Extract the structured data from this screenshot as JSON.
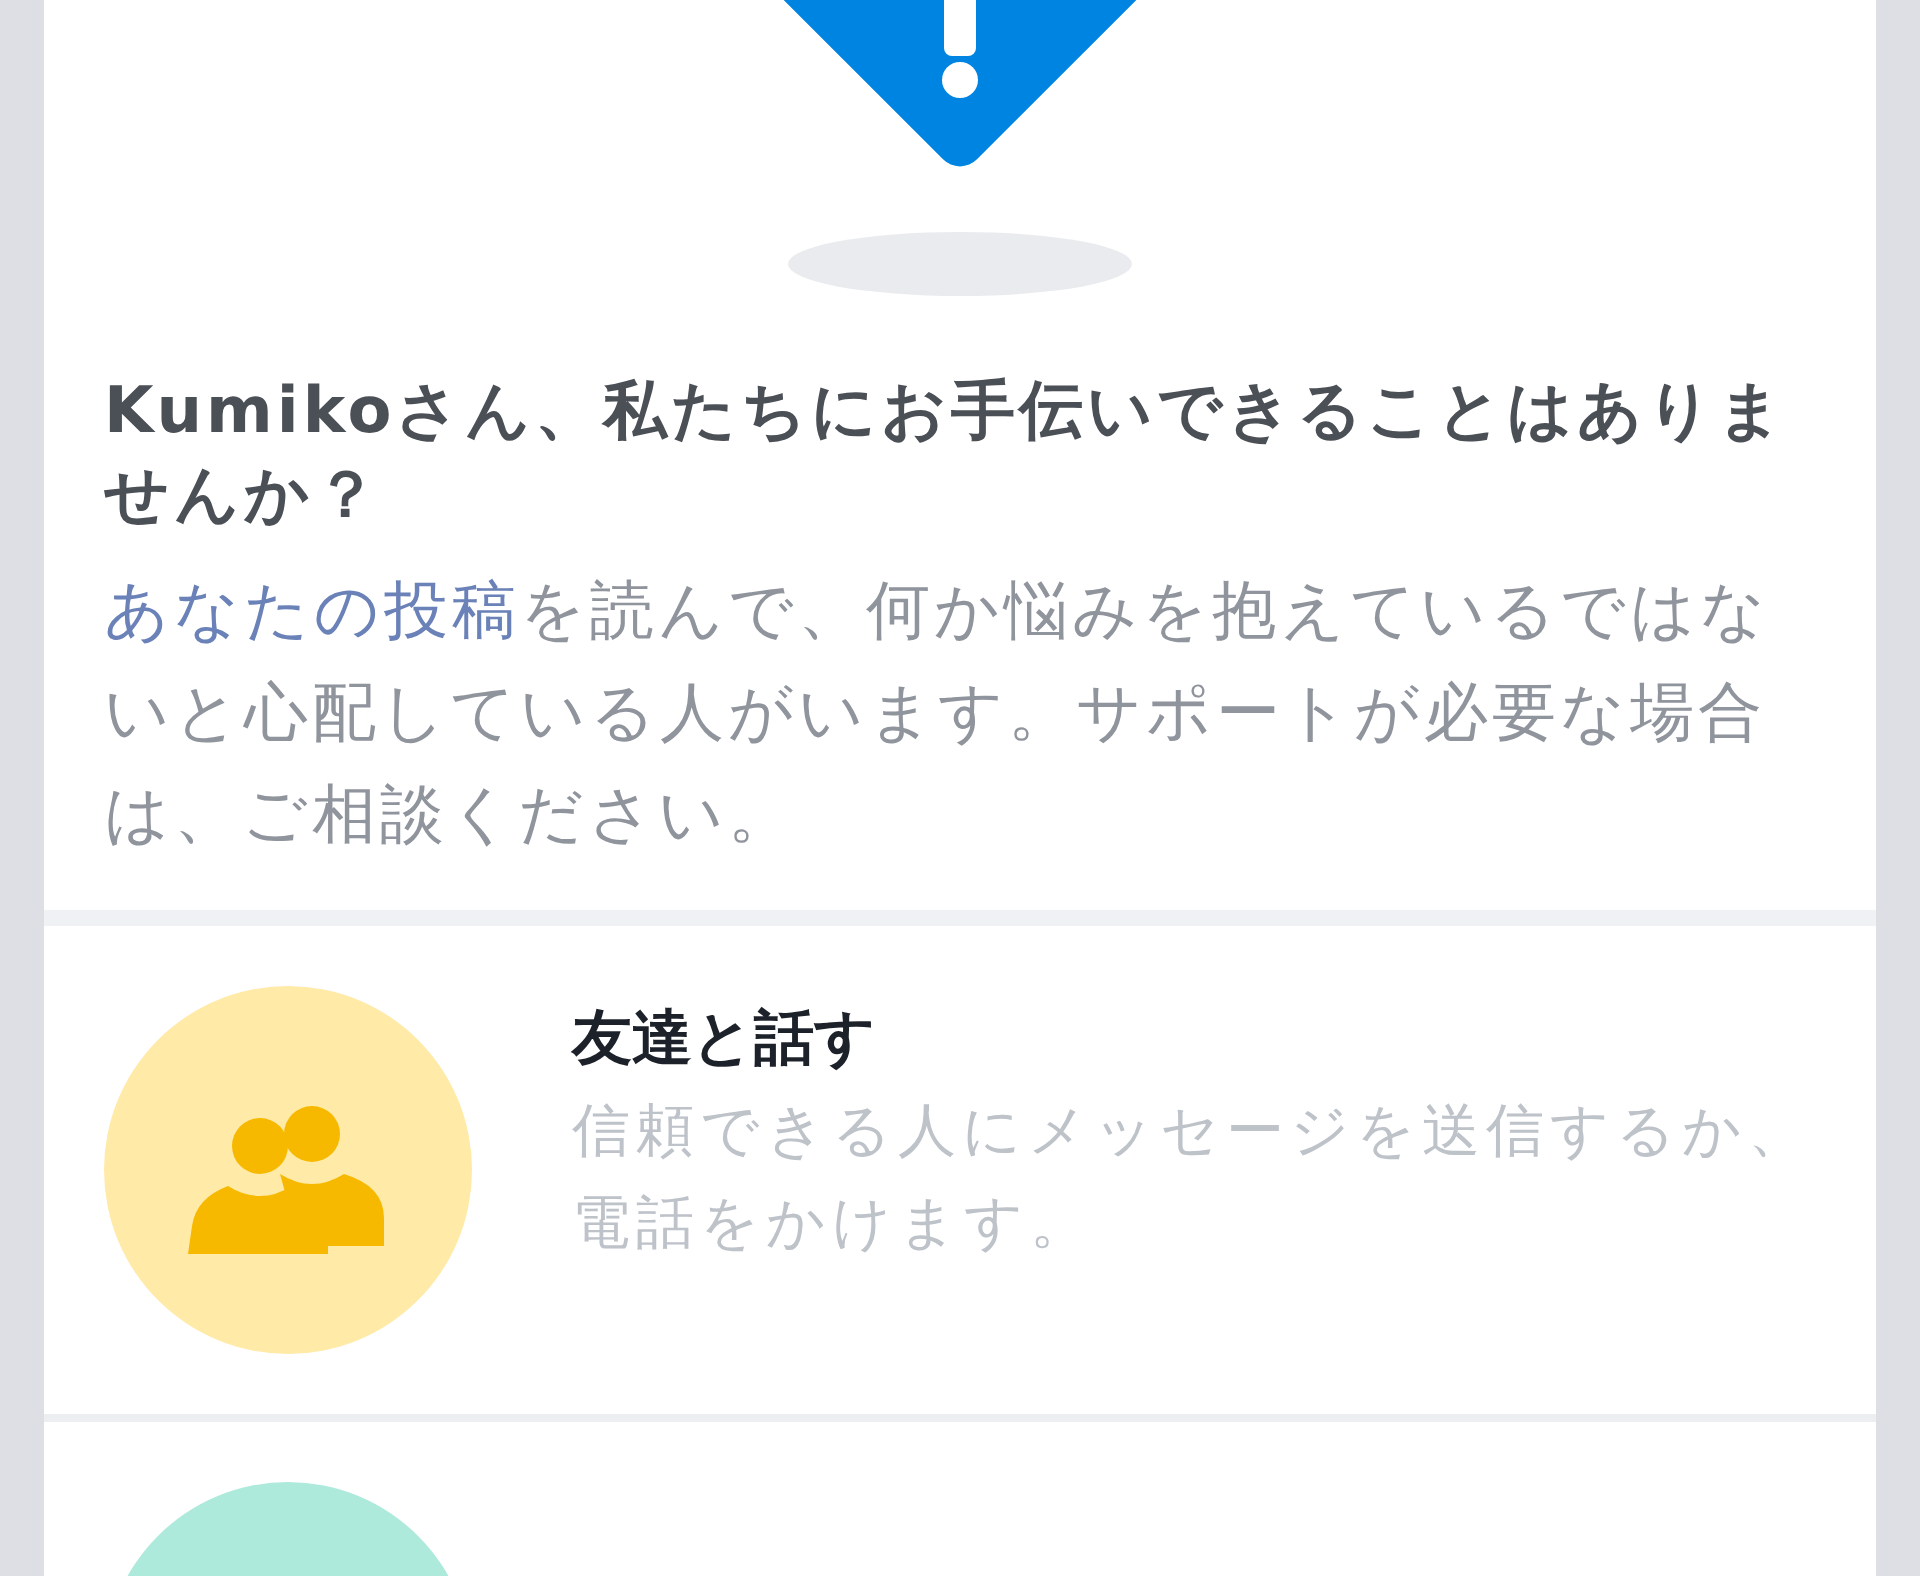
{
  "prompt": {
    "title": "Kumikoさん、私たちにお手伝いできることはありませんか？",
    "body_link": "あなたの投稿",
    "body_text": "を読んで、何か悩みを抱えているではないと心配している人がいます。サポートが必要な場合は、ご相談ください。"
  },
  "options": [
    {
      "kind": "friends",
      "color": "#ffeaa8",
      "title": "友達と話す",
      "description": "信頼できる人にメッセージを送信するか、電話をかけます。"
    },
    {
      "kind": "helpline",
      "color": "#aeeadc"
    }
  ]
}
